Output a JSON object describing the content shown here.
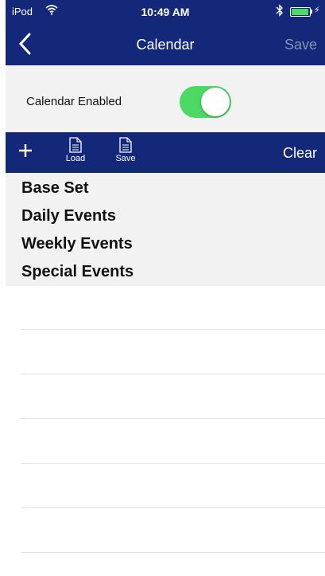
{
  "status": {
    "carrier": "iPod",
    "time": "10:49 AM",
    "battery_level": 0.95
  },
  "navbar": {
    "title": "Calendar",
    "back_icon": "chevron-left-icon",
    "save_label": "Save"
  },
  "settings": {
    "calendar_enabled_label": "Calendar Enabled",
    "calendar_enabled": true
  },
  "toolbar": {
    "add_icon": "plus-icon",
    "load_label": "Load",
    "save_label": "Save",
    "clear_label": "Clear"
  },
  "list": {
    "items": [
      "Base Set",
      "Daily Events",
      "Weekly Events",
      "Special Events"
    ]
  },
  "colors": {
    "header_bg": "#14287a",
    "toggle_on": "#4cd964",
    "list_bg": "#f2f2f2",
    "disabled_text": "#8a93b6"
  }
}
